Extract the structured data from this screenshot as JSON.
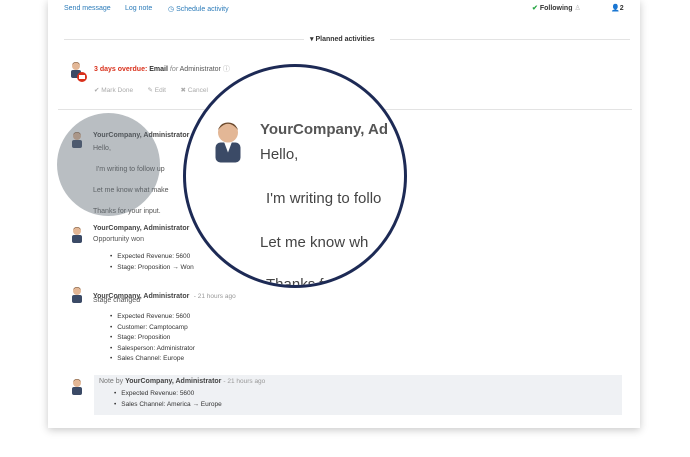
{
  "topbar": {
    "send_message": "Send message",
    "log_note": "Log note",
    "schedule_activity": "Schedule activity",
    "following": "Following",
    "followers_count": "2"
  },
  "planned": {
    "title": "Planned activities"
  },
  "activity": {
    "overdue": "3 days overdue:",
    "type": "Email",
    "for_label": "for",
    "assignee": "Administrator",
    "mark_done": "Mark Done",
    "edit": "Edit",
    "cancel": "Cancel"
  },
  "messages": [
    {
      "author": "YourCompany, Administrator",
      "lines": [
        "Hello,",
        "I'm writing to follow up",
        "Let me know what make",
        "Thanks for your input."
      ]
    },
    {
      "author": "YourCompany, Administrator",
      "subtitle": "Opportunity won",
      "changes": [
        "Expected Revenue: 5600",
        "Stage: Proposition → Won"
      ]
    },
    {
      "author": "YourCompany, Administrator",
      "time": "21 hours ago",
      "subtitle": "Stage changed",
      "changes": [
        "Expected Revenue: 5600",
        "Customer: Camptocamp",
        "Stage: Proposition",
        "Salesperson: Administrator",
        "Sales Channel: Europe"
      ]
    },
    {
      "note_prefix": "Note by",
      "author": "YourCompany, Administrator",
      "time": "21 hours ago",
      "changes": [
        "Expected Revenue: 5600",
        "Sales Channel: America → Europe"
      ]
    }
  ],
  "magnifier": {
    "author": "YourCompany, Ad",
    "hello": "Hello,",
    "line1": "I'm writing to follo",
    "line2": "Let me know wh",
    "line3": "Thanks f"
  },
  "colors": {
    "link": "#2b7bb9",
    "overdue": "#d9301b",
    "following": "#28a745",
    "lens_border": "#1d2a55"
  }
}
